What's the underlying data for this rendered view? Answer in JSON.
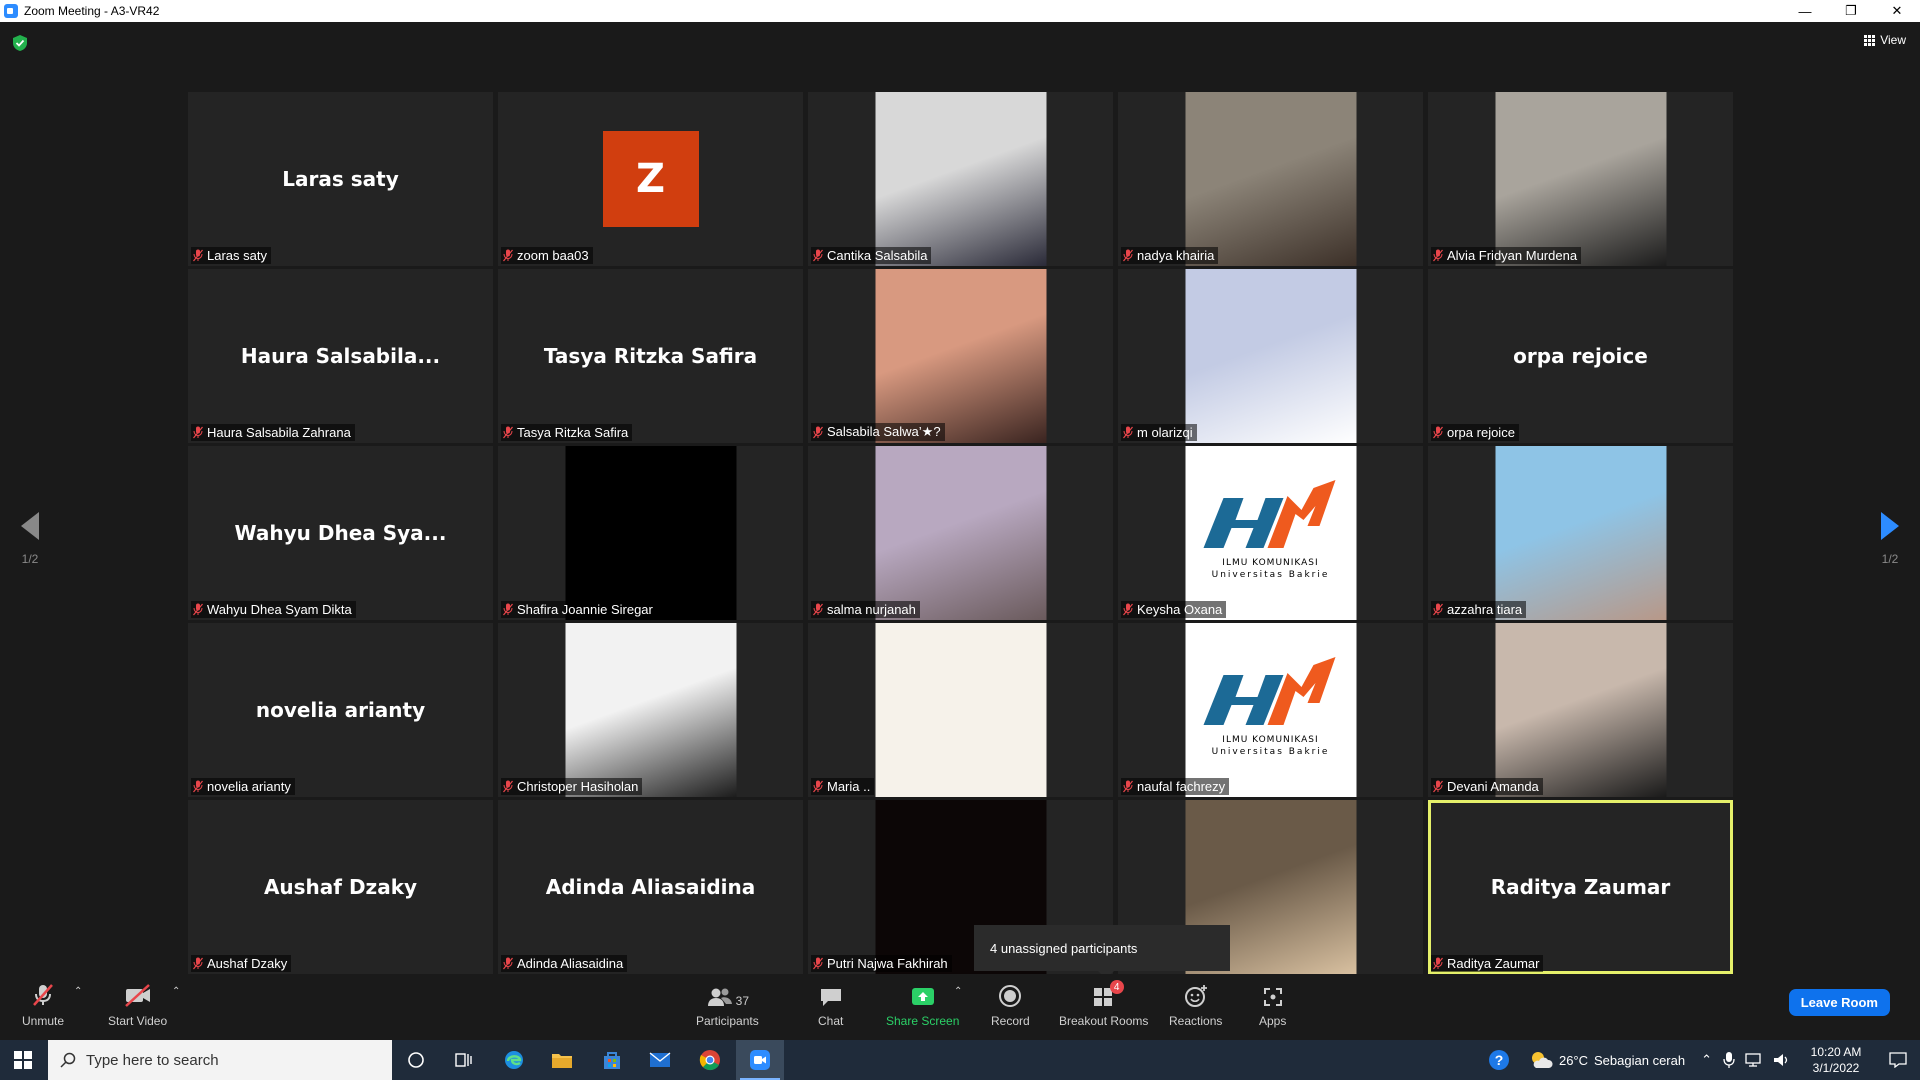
{
  "window": {
    "title": "Zoom Meeting - A3-VR42",
    "minimize": "—",
    "restore": "❐",
    "close": "✕"
  },
  "header": {
    "view_label": "View"
  },
  "pagination": {
    "left_page": "1/2",
    "right_page": "1/2"
  },
  "tiles": [
    {
      "display_name": "Laras saty",
      "caption": "Laras saty",
      "kind": "name"
    },
    {
      "display_name": "Z",
      "caption": "zoom baa03",
      "kind": "avatar"
    },
    {
      "display_name": "",
      "caption": "Cantika Salsabila",
      "kind": "video",
      "colors": [
        "#d8d8d8",
        "#2a2a38"
      ]
    },
    {
      "display_name": "",
      "caption": "nadya khairia",
      "kind": "video",
      "colors": [
        "#8c8478",
        "#3c3028"
      ]
    },
    {
      "display_name": "",
      "caption": "Alvia Fridyan Murdena",
      "kind": "video",
      "colors": [
        "#a9a49c",
        "#1c1c1c"
      ]
    },
    {
      "display_name": "Haura  Salsabila...",
      "caption": "Haura Salsabila Zahrana",
      "kind": "name"
    },
    {
      "display_name": "Tasya Ritzka Safira",
      "caption": "Tasya Ritzka Safira",
      "kind": "name"
    },
    {
      "display_name": "",
      "caption": "Salsabila Salwa’★?",
      "kind": "video",
      "colors": [
        "#d89980",
        "#3a2420"
      ]
    },
    {
      "display_name": "",
      "caption": "m olarizqi",
      "kind": "video",
      "colors": [
        "#c3cbe4",
        "#ffffff"
      ]
    },
    {
      "display_name": "orpa rejoice",
      "caption": "orpa rejoice",
      "kind": "name"
    },
    {
      "display_name": "Wahyu  Dhea  Sya...",
      "caption": "Wahyu Dhea Syam Dikta",
      "kind": "name"
    },
    {
      "display_name": "",
      "caption": "Shafira Joannie Siregar",
      "kind": "video",
      "colors": [
        "#000000",
        "#000000"
      ]
    },
    {
      "display_name": "",
      "caption": "salma nurjanah",
      "kind": "video",
      "colors": [
        "#b8a8c0",
        "#6a5a5c"
      ]
    },
    {
      "display_name": "",
      "caption": "Keysha Oxana",
      "kind": "logo",
      "colors": [
        "#ffffff",
        "#1c6a96"
      ]
    },
    {
      "display_name": "",
      "caption": "azzahra tiara",
      "kind": "video",
      "colors": [
        "#8ec4e6",
        "#b89888"
      ]
    },
    {
      "display_name": "novelia arianty",
      "caption": "novelia arianty",
      "kind": "name"
    },
    {
      "display_name": "",
      "caption": "Christoper Hasiholan",
      "kind": "video",
      "colors": [
        "#f2f2f2",
        "#1c1c1c"
      ]
    },
    {
      "display_name": "",
      "caption": "Maria ..",
      "kind": "video",
      "colors": [
        "#f6f2ea",
        "#f6f2ea"
      ]
    },
    {
      "display_name": "",
      "caption": "naufal fachrezy",
      "kind": "logo",
      "colors": [
        "#ffffff",
        "#1c6a96"
      ]
    },
    {
      "display_name": "",
      "caption": "Devani Amanda",
      "kind": "video",
      "colors": [
        "#c8b8ac",
        "#1a1a1a"
      ]
    },
    {
      "display_name": "Aushaf Dzaky",
      "caption": "Aushaf Dzaky",
      "kind": "name"
    },
    {
      "display_name": "Adinda Aliasaidina",
      "caption": "Adinda Aliasaidina",
      "kind": "name"
    },
    {
      "display_name": "",
      "caption": "Putri Najwa Fakhirah",
      "kind": "video",
      "colors": [
        "#0c0606",
        "#0c0606"
      ]
    },
    {
      "display_name": "",
      "caption": "",
      "kind": "video",
      "colors": [
        "#6a5a48",
        "#d8c0a0"
      ]
    },
    {
      "display_name": "Raditya Zaumar",
      "caption": "Raditya Zaumar",
      "kind": "name",
      "active": true
    }
  ],
  "logo_text": {
    "line1": "ILMU KOMUNIKASI",
    "line2": "Universitas Bakrie"
  },
  "notification": "4 unassigned participants",
  "toolbar": {
    "unmute": "Unmute",
    "start_video": "Start Video",
    "participants": "Participants",
    "participants_count": "37",
    "chat": "Chat",
    "share_screen": "Share Screen",
    "record": "Record",
    "breakout_rooms": "Breakout Rooms",
    "breakout_badge": "4",
    "reactions": "Reactions",
    "apps": "Apps",
    "leave_room": "Leave Room"
  },
  "taskbar": {
    "search_placeholder": "Type here to search",
    "weather_temp": "26°C",
    "weather_desc": "Sebagian cerah",
    "time": "10:20 AM",
    "date": "3/1/2022"
  },
  "colors": {
    "accent": "#2d8cff",
    "active_speaker": "#e5f06a",
    "muted_red": "#e8464b",
    "share_green": "#2bd067",
    "avatar_orange": "#d13e0f"
  }
}
